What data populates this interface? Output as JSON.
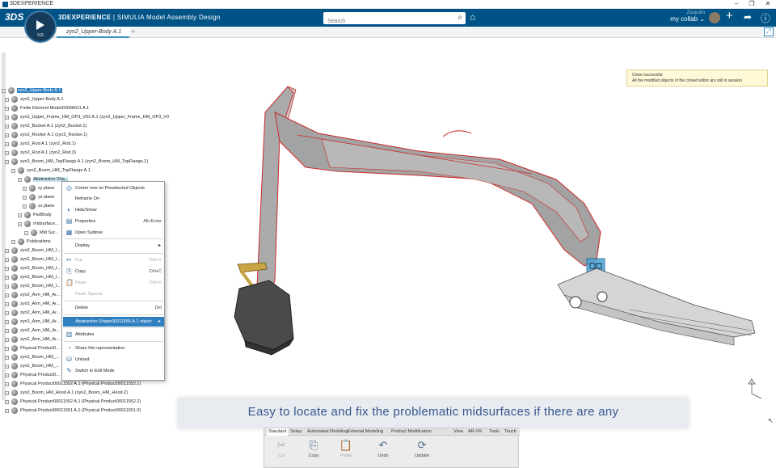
{
  "os": {
    "title": "3DEXPERIENCE",
    "minimize": "–",
    "maximize": "❐",
    "close": "✕"
  },
  "topbar": {
    "logo": "3DS",
    "brand_bold": "3DEXPERIENCE",
    "brand_rest": " | SIMULIA Model Assembly Design",
    "search_placeholder": "Search",
    "user_name": "Zsuyulin",
    "collab_space": "my collab ⌄",
    "compass_version": "V.R"
  },
  "tab": {
    "label": "zyn2_Upper-Body A.1",
    "add": "+"
  },
  "tree": {
    "rows": [
      {
        "label": "zyn2_Upper-Body A.1",
        "selected": true
      },
      {
        "label": "zyn2_Upper-Body A.1"
      },
      {
        "label": "Finite Element Model00058011 A.1"
      },
      {
        "label": "zyn2_Upper_Frame_HM_OP3_V02 A.1 (zyn2_Upper_Frame_HM_OP3_V0"
      },
      {
        "label": "zyn2_Bucket A.1 (zyn2_Bucket.1)"
      },
      {
        "label": "zyn2_Rocker A.1 (zyn2_Rocker.1)"
      },
      {
        "label": "zyn2_Rod A.1 (zyn2_Rod.1)"
      },
      {
        "label": "zyn2_Rod A.1 (zyn2_Rod.3)"
      },
      {
        "label": "zyn2_Boom_HM_TopFlange A.1 (zyn2_Boom_HM_TopFlange.1)"
      },
      {
        "label": "zyn2_Boom_HM_TopFlange A.1"
      },
      {
        "label": "Abstraction Sha...",
        "highlight": true
      },
      {
        "label": "xy plane"
      },
      {
        "label": "yz plane"
      },
      {
        "label": "zx plane"
      },
      {
        "label": "PartBody"
      },
      {
        "label": "midsurface..."
      },
      {
        "label": "Mid Sur..."
      },
      {
        "label": "Publications"
      },
      {
        "label": "zyn2_Boom_HM_I..."
      },
      {
        "label": "zyn2_Boom_HM_I..."
      },
      {
        "label": "zyn2_Boom_HM_I..."
      },
      {
        "label": "zyn2_Boom_HM_I..."
      },
      {
        "label": "zyn2_Boom_HM_I..."
      },
      {
        "label": "zyn2_Arm_HM_Ar..."
      },
      {
        "label": "zyn2_Arm_HM_Ar..."
      },
      {
        "label": "zyn2_Arm_HM_Ar..."
      },
      {
        "label": "zyn2_Arm_HM_Ar..."
      },
      {
        "label": "zyn2_Arm_HM_Ar..."
      },
      {
        "label": "zyn2_Arm_HM_Ar..."
      },
      {
        "label": "Physical Product0..."
      },
      {
        "label": "zyn2_Boom_HM_..."
      },
      {
        "label": "zyn2_Boom_HM_..."
      },
      {
        "label": "Physical Product0..."
      },
      {
        "label": "Physical Product00011552 A.1 (Physical Product00011552.1)"
      },
      {
        "label": "zyn2_Boom_HM_Hood A.1 (zyn2_Boom_HM_Hood.2)"
      },
      {
        "label": "Physical Product00011552 A.1 (Physical Product00011552.2)"
      },
      {
        "label": "Physical Product00011551 A.1 (Physical Product00011551.0)"
      }
    ]
  },
  "context_menu": {
    "items": [
      {
        "label": "Center tree on Preselected Objects",
        "icon": "◎"
      },
      {
        "label": "Reframe On",
        "icon": ""
      },
      {
        "label": "Hide/Show",
        "icon": "◐"
      },
      {
        "label": "Properties",
        "key": "Alt+Enter",
        "icon": "▤"
      },
      {
        "label": "Open Subtree",
        "icon": "▦"
      },
      {
        "label": "Display",
        "submenu": true,
        "icon": ""
      },
      {
        "label": "Cut",
        "key": "Ctrl+X",
        "disabled": true,
        "icon": "✂"
      },
      {
        "label": "Copy",
        "key": "Ctrl+C",
        "icon": "⎘"
      },
      {
        "label": "Paste",
        "key": "Ctrl+V",
        "disabled": true,
        "icon": "📋"
      },
      {
        "label": "Paste Special",
        "disabled": true,
        "icon": ""
      },
      {
        "label": "Delete",
        "key": "Del",
        "icon": ""
      },
      {
        "label": "Abstraction Shape00011555 A.1 object",
        "submenu": true,
        "hover": true,
        "icon": ""
      },
      {
        "label": "Attributes",
        "icon": "▥"
      },
      {
        "label": "Share this representation",
        "icon": "◔"
      },
      {
        "label": "Unload",
        "icon": "⛁"
      },
      {
        "label": "Switch to Edit Mode",
        "icon": "✎"
      }
    ]
  },
  "notice": {
    "line1": "Close successful",
    "line2": "All the modified objects of the closed editor are still in session"
  },
  "caption": "Easy to locate and fix the problematic midsurfaces if there are any",
  "action_bar": {
    "tabs": [
      "Standard",
      "Setup",
      "Automated Modeling",
      "External Modeling",
      "Product Modification",
      "View",
      "AR-VR",
      "Tools",
      "Touch"
    ],
    "buttons": [
      {
        "label": "Cut",
        "icon": "✂",
        "disabled": true
      },
      {
        "label": "Copy",
        "icon": "⎘"
      },
      {
        "label": "Paste",
        "icon": "📋",
        "disabled": true
      },
      {
        "label": "Undo",
        "icon": "↶"
      },
      {
        "label": "Update",
        "icon": "⟳"
      }
    ]
  },
  "colors": {
    "brand": "#005386",
    "selection": "#2e7fc0",
    "edge": "#cc2a2a",
    "caption_text": "#36578d"
  }
}
